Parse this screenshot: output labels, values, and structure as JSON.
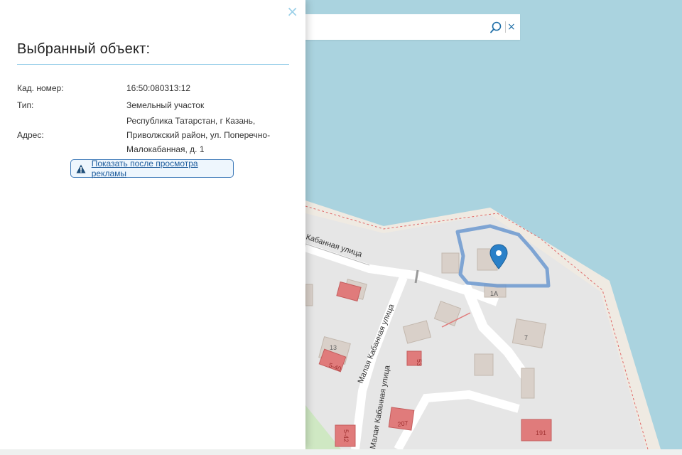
{
  "panel": {
    "close_label": "×",
    "title": "Выбранный объект:",
    "fields": [
      {
        "label": "Кад. номер:",
        "value": "16:50:080313:12"
      },
      {
        "label": "Тип:",
        "value": "Земельный участок"
      },
      {
        "label": "Адрес:",
        "value_lines": [
          "Республика Татарстан, г Казань,",
          "Приволжский район, ул. Поперечно-",
          "Малокабанная, д. 1"
        ]
      }
    ],
    "ad_button_label": "Показать после просмотра рекламы"
  },
  "search": {
    "value": "",
    "placeholder": "",
    "clear_label": "×"
  },
  "map": {
    "street_labels": [
      "Кабанная улица",
      "Малая Кабанная улица",
      "Малая Кабанная улица"
    ],
    "house_numbers": [
      "1А",
      "7",
      "5-40",
      "53",
      "207",
      "5-42",
      "191",
      "13"
    ],
    "colors": {
      "water": "#aad3df",
      "land": "#e8e8e8",
      "building": "#d9d0c9",
      "cadastral_building": "#e07b7b",
      "parcel_outline": "#6b98cf",
      "marker": "#2a80c8"
    }
  },
  "icons": {
    "search": "magnifier-icon",
    "close": "close-icon",
    "warning": "warning-icon",
    "marker": "map-pin-icon"
  }
}
